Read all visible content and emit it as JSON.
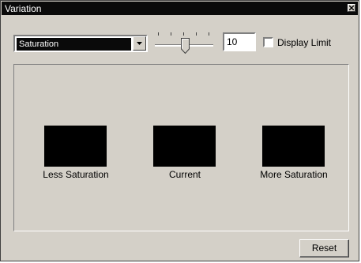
{
  "window": {
    "title": "Variation"
  },
  "controls": {
    "mode_select_value": "Saturation",
    "slider_value": 10,
    "number_value": "10",
    "display_limit_label": "Display Limit",
    "display_limit_checked": false
  },
  "previews": [
    {
      "label": "Less Saturation",
      "color": "#000000"
    },
    {
      "label": "Current",
      "color": "#000000"
    },
    {
      "label": "More Saturation",
      "color": "#000000"
    }
  ],
  "buttons": {
    "reset_label": "Reset"
  },
  "icons": [
    "close-icon",
    "dropdown-arrow-icon",
    "slider-thumb-icon"
  ]
}
